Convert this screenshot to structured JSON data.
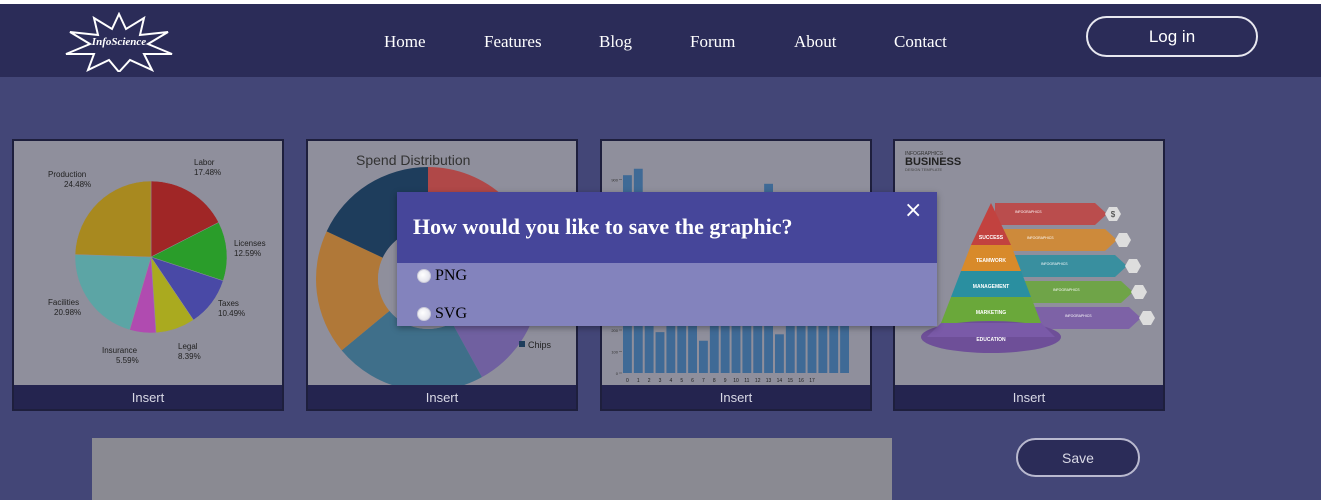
{
  "navbar": {
    "logo_text": "InfoScience",
    "links": [
      "Home",
      "Features",
      "Blog",
      "Forum",
      "About",
      "Contact"
    ],
    "login_label": "Log in"
  },
  "cards": [
    {
      "insert_label": "Insert"
    },
    {
      "insert_label": "Insert"
    },
    {
      "insert_label": "Insert"
    },
    {
      "insert_label": "Insert"
    }
  ],
  "save_label": "Save",
  "modal": {
    "title": "How would you like to save the graphic?",
    "close_symbol": "×",
    "options": [
      "PNG",
      "SVG"
    ]
  },
  "thumbnails": {
    "pie": {
      "slices": [
        {
          "label": "Labor",
          "pct": "17.48%",
          "value": 17.48,
          "color": "#a02626"
        },
        {
          "label": "Licenses",
          "pct": "12.59%",
          "value": 12.59,
          "color": "#2a9d2a"
        },
        {
          "label": "Taxes",
          "pct": "10.49%",
          "value": 10.49,
          "color": "#4949a6"
        },
        {
          "label": "Legal",
          "pct": "8.39%",
          "value": 8.39,
          "color": "#aaaa1f"
        },
        {
          "label": "Insurance",
          "pct": "5.59%",
          "value": 5.59,
          "color": "#b04bb0"
        },
        {
          "label": "Facilities",
          "pct": "20.98%",
          "value": 20.98,
          "color": "#5ca5a5"
        },
        {
          "label": "Production",
          "pct": "24.48%",
          "value": 24.48,
          "color": "#a8891f"
        }
      ]
    },
    "donut": {
      "title": "Spend Distribution",
      "legend_item": "Chips",
      "colors": [
        "#b04848",
        "#7060a0",
        "#3f6f8a",
        "#b07838",
        "#1e3d5c"
      ]
    },
    "bar": {
      "y_ticks": [
        "0",
        "100",
        "200",
        "300",
        "400",
        "500",
        "600",
        "700",
        "800",
        "900"
      ],
      "x_ticks": [
        "0",
        "1",
        "2",
        "3",
        "4",
        "5",
        "6",
        "7",
        "8",
        "9",
        "10",
        "11",
        "12",
        "13",
        "14",
        "15",
        "16",
        "17"
      ],
      "values": [
        920,
        950,
        300,
        190,
        320,
        820,
        400,
        150,
        830,
        680,
        730,
        780,
        320,
        880,
        180,
        610,
        550,
        690,
        650,
        500,
        720
      ],
      "color": "#3f6a96"
    },
    "infographic": {
      "title_small": "INFOGRAPHICS",
      "title_big": "BUSINESS",
      "subtitle": "DESIGN TEMPLATE",
      "layers": [
        "SUCCESS",
        "TEAMWORK",
        "MANAGEMENT",
        "MARKETING",
        "EDUCATION"
      ],
      "layer_colors": [
        "#c2423f",
        "#d88a2a",
        "#2a8fa0",
        "#6aa83a",
        "#7a5aa8"
      ],
      "side_label": "INFOGRAPHICS",
      "icons": [
        "$",
        "person",
        "chart",
        "gears",
        "brain"
      ]
    }
  }
}
